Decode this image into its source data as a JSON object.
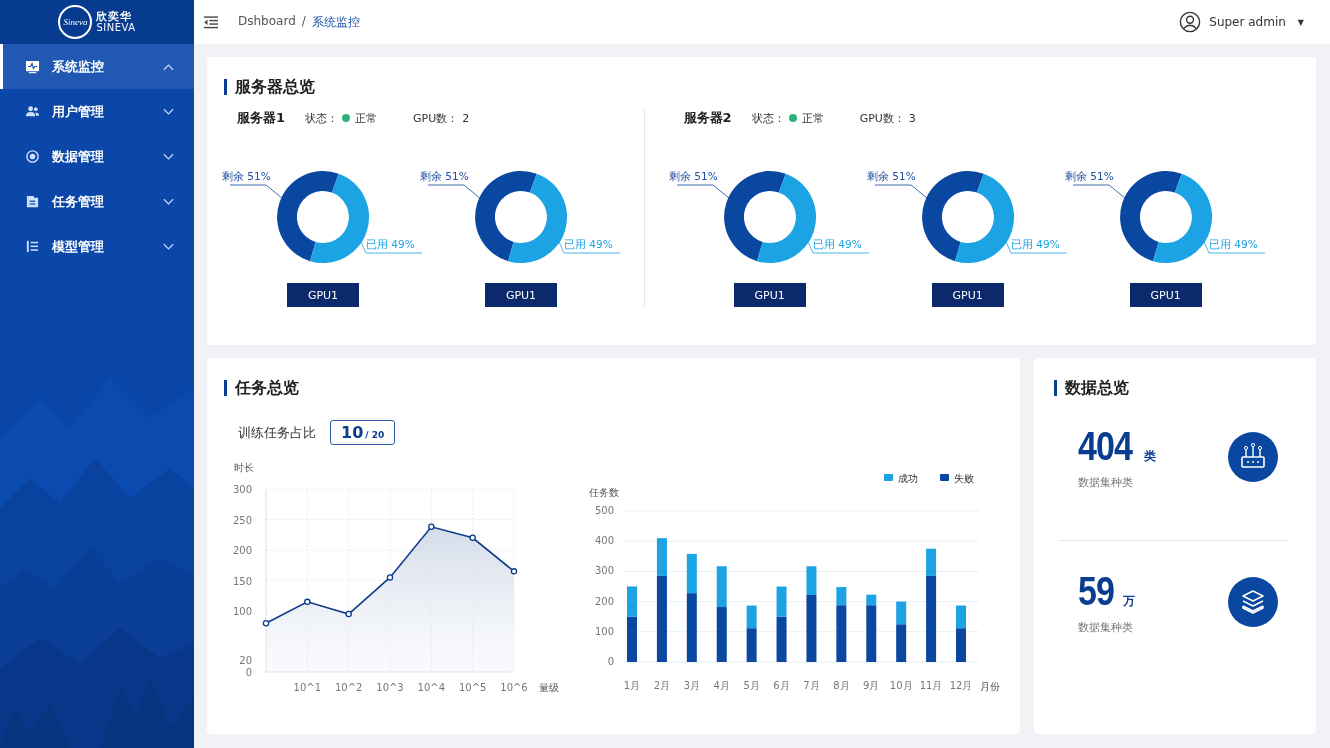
{
  "logo": {
    "mark": "Sineva",
    "name_cn": "欣奕华",
    "name_en": "SINEVA"
  },
  "sidebar": {
    "items": [
      {
        "label": "系统监控",
        "selected": true,
        "expanded": true
      },
      {
        "label": "用户管理",
        "selected": false,
        "expanded": false
      },
      {
        "label": "数据管理",
        "selected": false,
        "expanded": false
      },
      {
        "label": "任务管理",
        "selected": false,
        "expanded": false
      },
      {
        "label": "模型管理",
        "selected": false,
        "expanded": false
      }
    ]
  },
  "header": {
    "breadcrumb": [
      "Dshboard",
      "系统监控"
    ],
    "separator": "/",
    "user": "Super admin",
    "caret": "▼"
  },
  "server_overview": {
    "title": "服务器总览",
    "servers": [
      {
        "name": "服务器1",
        "status_label": "状态：",
        "status": "正常",
        "color": "#2db37a",
        "gpu_label": "GPU数：",
        "gpu_count": "2",
        "gpus": [
          {
            "label": "GPU1",
            "chart_data": {
              "type": "donut",
              "values": [
                51,
                49
              ],
              "value_labels": [
                "剩余 51%",
                "已用 49%"
              ]
            }
          },
          {
            "label": "GPU1",
            "chart_data": {
              "type": "donut",
              "values": [
                51,
                49
              ],
              "value_labels": [
                "剩余 51%",
                "已用 49%"
              ]
            }
          }
        ]
      },
      {
        "name": "服务器2",
        "status_label": "状态：",
        "status": "正常",
        "color": "#2db37a",
        "gpu_label": "GPU数：",
        "gpu_count": "3",
        "gpus": [
          {
            "label": "GPU1",
            "chart_data": {
              "type": "donut",
              "values": [
                51,
                49
              ],
              "value_labels": [
                "剩余 51%",
                "已用 49%"
              ]
            }
          },
          {
            "label": "GPU1",
            "chart_data": {
              "type": "donut",
              "values": [
                51,
                49
              ],
              "value_labels": [
                "剩余 51%",
                "已用 49%"
              ]
            }
          },
          {
            "label": "GPU1",
            "chart_data": {
              "type": "donut",
              "values": [
                51,
                49
              ],
              "value_labels": [
                "剩余 51%",
                "已用 49%"
              ]
            }
          }
        ]
      }
    ]
  },
  "task_overview": {
    "title": "任务总览",
    "ratio_label": "训练任务占比",
    "ratio_done": "10",
    "ratio_total": "/ 20",
    "line_chart": {
      "chart_data": {
        "type": "area",
        "xlabel": "量级",
        "ylabel": "时长",
        "grid": true,
        "categories": [
          null,
          "10^1",
          "10^2",
          "10^3",
          "10^4",
          "10^5",
          "10^6"
        ],
        "series": [
          {
            "color": "#0d3b8c",
            "values": [
              80,
              115,
              95,
              155,
              238,
              220,
              165
            ]
          }
        ],
        "ylim": [
          0,
          300
        ],
        "yticks": [
          0,
          20,
          100,
          150,
          200,
          250,
          300
        ]
      }
    },
    "bar_chart": {
      "chart_data": {
        "type": "bar",
        "stacked": true,
        "grid": true,
        "legend": "top-right",
        "xlabel": "月份",
        "ylabel": "任务数",
        "categories": [
          "1月",
          "2月",
          "3月",
          "4月",
          "5月",
          "6月",
          "7月",
          "8月",
          "9月",
          "10月",
          "11月",
          "12月"
        ],
        "series": [
          {
            "name": "成功",
            "color": "#1ba3e3",
            "values": [
              100,
              125,
              130,
              135,
              75,
              100,
              95,
              60,
              35,
              75,
              90,
              75
            ]
          },
          {
            "name": "失败",
            "color": "#0a47a0",
            "values": [
              150,
              285,
              228,
              182,
              112,
              150,
              222,
              188,
              188,
              125,
              285,
              112
            ]
          }
        ],
        "ylim": [
          0,
          500
        ],
        "yticks": [
          0,
          100,
          200,
          300,
          400,
          500
        ]
      }
    }
  },
  "data_overview": {
    "title": "数据总览",
    "stats": [
      {
        "value": "404",
        "unit": "类",
        "label": "数据集种类"
      },
      {
        "value": "59",
        "unit": "万",
        "label": "数据集种类"
      }
    ]
  }
}
